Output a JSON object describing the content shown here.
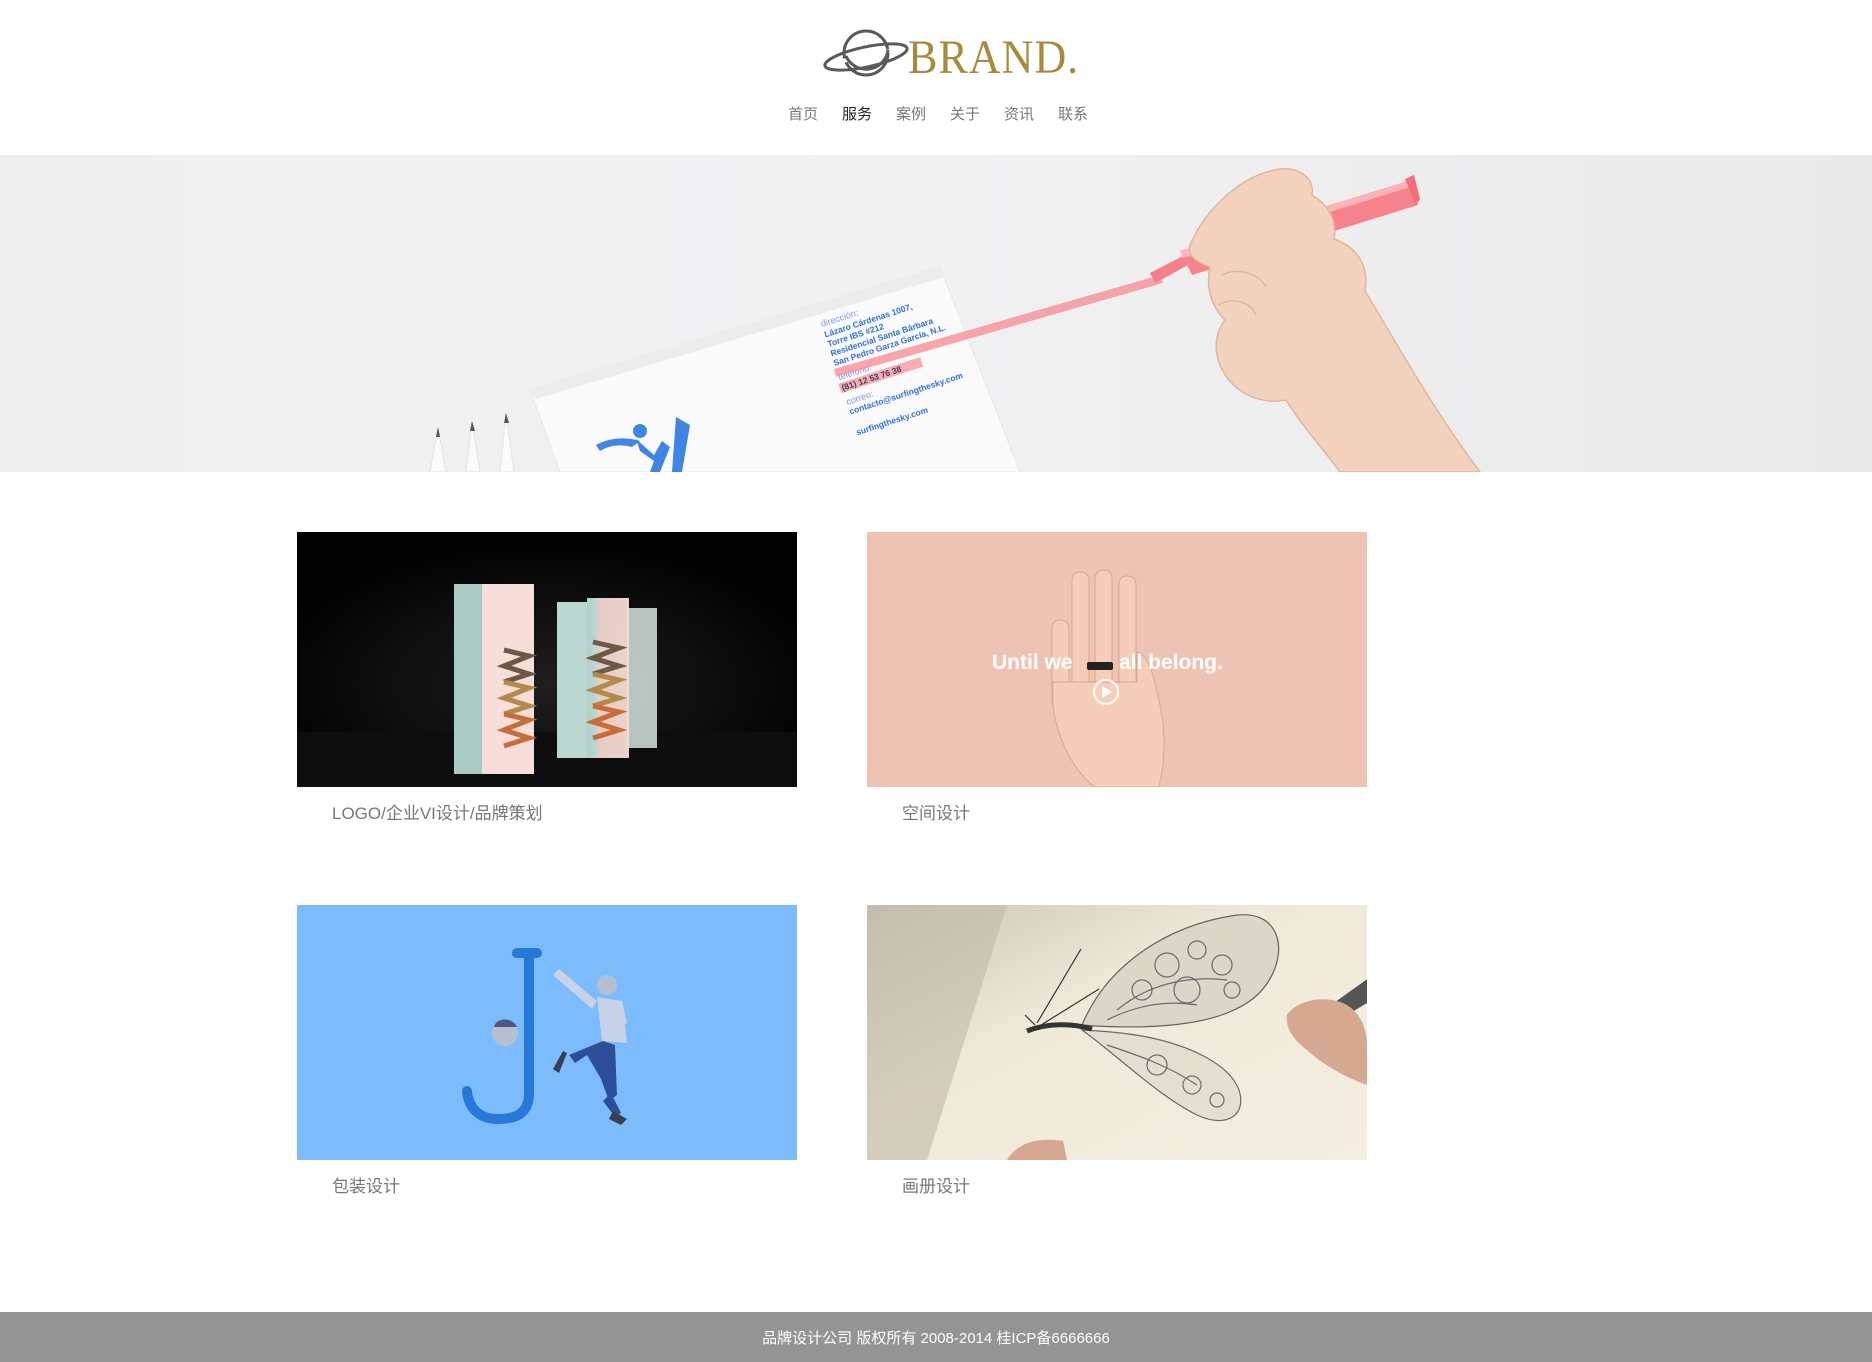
{
  "brand": {
    "name": "BRAND.",
    "colors": {
      "gold": "#a88a3c",
      "planet": "#5a5a5a"
    }
  },
  "nav": {
    "items": [
      {
        "label": "首页",
        "active": false
      },
      {
        "label": "服务",
        "active": true
      },
      {
        "label": "案例",
        "active": false
      },
      {
        "label": "关于",
        "active": false
      },
      {
        "label": "资讯",
        "active": false
      },
      {
        "label": "联系",
        "active": false
      }
    ]
  },
  "banner": {
    "card_lines": [
      "dirección:",
      "Lázaro Cárdenas 1007,",
      "Torre IBS #212",
      "Residencial Santa Bárbara",
      "San Pedro Garza García, N.L.",
      "teléfono:",
      "(81) 12 53 76 38",
      "correo:",
      "contacto@surfingthesky.com",
      "surfingthesky.com"
    ],
    "highlighter_color": "#f78a92"
  },
  "services": [
    {
      "caption": "LOGO/企业VI设计/品牌策划",
      "image": "www-boxes-photo"
    },
    {
      "caption": "空间设计",
      "image": "hand-ring-photo",
      "image_text": "Until we",
      "image_text_2": "all belong."
    },
    {
      "caption": "包装设计",
      "image": "letter-j-figure-photo"
    },
    {
      "caption": "画册设计",
      "image": "butterfly-drawing-photo"
    }
  ],
  "footer": {
    "text": "品牌设计公司 版权所有 2008-2014 桂ICP备6666666"
  }
}
